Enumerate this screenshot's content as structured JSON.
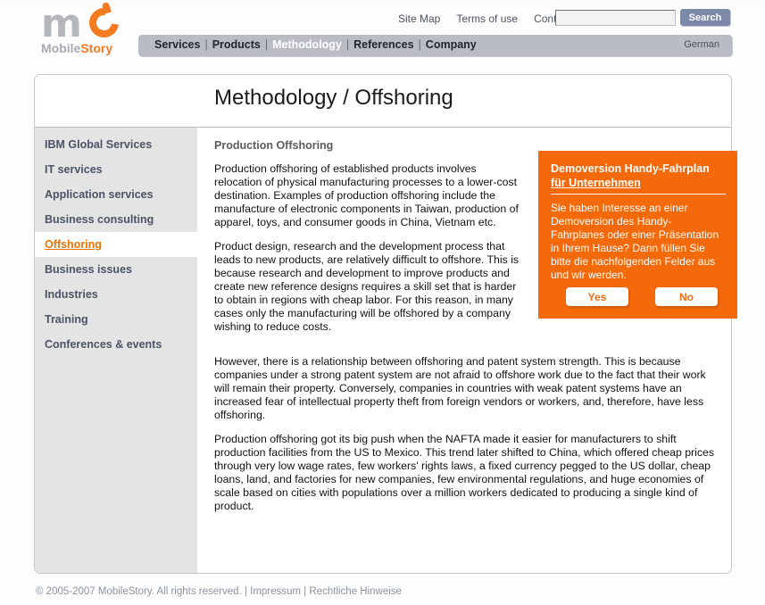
{
  "brand": {
    "logo_primary": "Mobile",
    "logo_accent": "Story",
    "logo_mark_letter": "m",
    "accent_color": "#f4690a",
    "nav_bg_color": "#b9bcc4",
    "sidebar_bg_color": "#e4e4e4"
  },
  "utility": {
    "links": [
      {
        "label": "Site Map"
      },
      {
        "label": "Terms of use"
      },
      {
        "label": "Contact"
      }
    ],
    "search_value": "",
    "search_placeholder": "",
    "search_button": "Search"
  },
  "nav": {
    "items": [
      {
        "label": "Services",
        "active": false
      },
      {
        "label": "Products",
        "active": false
      },
      {
        "label": "Methodology",
        "active": true
      },
      {
        "label": "References",
        "active": false
      },
      {
        "label": "Company",
        "active": false
      }
    ],
    "separator": "|",
    "language": "German"
  },
  "page": {
    "title": "Methodology / Offshoring",
    "section_title": "Production Offshoring"
  },
  "sidebar": {
    "items": [
      {
        "label": "IBM Global Services",
        "active": false
      },
      {
        "label": "IT services",
        "active": false
      },
      {
        "label": "Application services",
        "active": false
      },
      {
        "label": "Business consulting",
        "active": false
      },
      {
        "label": "Offshoring",
        "active": true
      },
      {
        "label": "Business issues",
        "active": false
      },
      {
        "label": "Industries",
        "active": false
      },
      {
        "label": "Training",
        "active": false
      },
      {
        "label": "Conferences & events",
        "active": false
      }
    ]
  },
  "content": {
    "paragraphs": [
      "Production offshoring of established products involves relocation of physical manufacturing processes to a lower-cost destination. Examples of production offshoring include the manufacture of electronic components in Taiwan, production of apparel, toys, and consumer goods in China, Vietnam etc.",
      "Product design, research and the development process that leads to new products, are relatively difficult to offshore. This is because research and development to improve products and create new reference designs requires a skill set that is harder to obtain in regions with cheap labor. For this reason, in many cases only the manufacturing will be offshored by a company wishing to reduce costs.",
      "However, there is a relationship between offshoring and patent system strength. This is because companies under a strong patent system are not afraid to offshore work due to the fact that their work will remain their property. Conversely, companies in countries with weak patent systems have an increased fear of intellectual property theft from foreign vendors or workers, and, therefore, have less offshoring.",
      "Production offshoring got its big push when the NAFTA made it easier for manufacturers to shift production facilities from the US to Mexico. This trend later shifted to China, which offered cheap prices through very low wage rates, few workers' rights laws, a fixed currency pegged to the US dollar, cheap loans, land, and factories for new companies, few environmental regulations, and huge economies of scale based on cities with populations over a million workers dedicated to producing a single kind of product."
    ]
  },
  "promo": {
    "title_line1": "Demoversion Handy-Fahrplan",
    "title_line2": "für Unternehmen",
    "body": "Sie haben Interesse an einer Demoversion des Handy-Fahrplanes oder einer Präsentation in Ihrem Hause? Dann füllen Sie bitte die nachfolgenden Felder aus und wir werden.",
    "yes_label": "Yes",
    "no_label": "No",
    "bg_color": "#f4690a"
  },
  "footer": {
    "copyright": "© 2005-2007 MobileStory. All rights reserved.",
    "separator": "|",
    "link1": "Impressum",
    "link2": "Rechtliche Hinweise"
  }
}
